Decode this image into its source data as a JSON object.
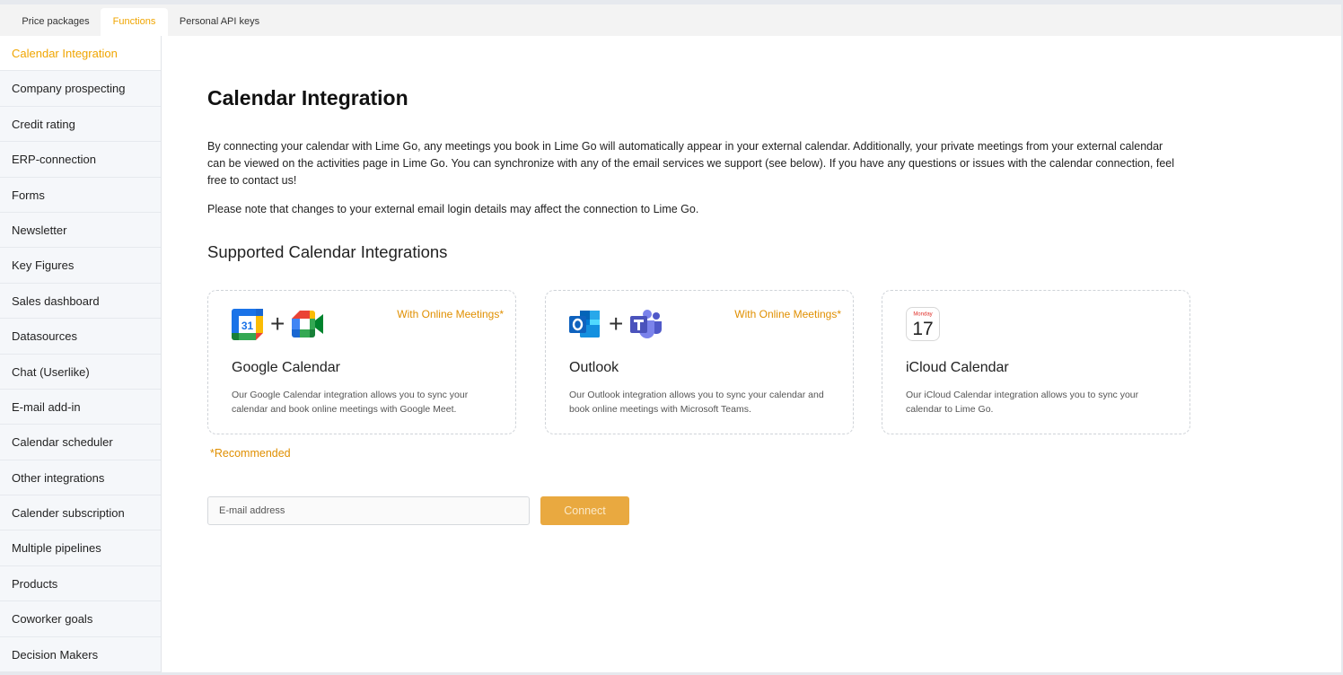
{
  "tabs": [
    {
      "label": "Price packages"
    },
    {
      "label": "Functions",
      "active": true
    },
    {
      "label": "Personal API keys"
    }
  ],
  "sidebar": {
    "items": [
      {
        "label": "Calendar Integration",
        "active": true
      },
      {
        "label": "Company prospecting"
      },
      {
        "label": "Credit rating"
      },
      {
        "label": "ERP-connection"
      },
      {
        "label": "Forms"
      },
      {
        "label": "Newsletter"
      },
      {
        "label": "Key Figures"
      },
      {
        "label": "Sales dashboard"
      },
      {
        "label": "Datasources"
      },
      {
        "label": "Chat (Userlike)"
      },
      {
        "label": "E-mail add-in"
      },
      {
        "label": "Calendar scheduler"
      },
      {
        "label": "Other integrations"
      },
      {
        "label": "Calender subscription"
      },
      {
        "label": "Multiple pipelines"
      },
      {
        "label": "Products"
      },
      {
        "label": "Coworker goals"
      },
      {
        "label": "Decision Makers"
      }
    ]
  },
  "main": {
    "title": "Calendar Integration",
    "intro": "By connecting your calendar with Lime Go, any meetings you book in Lime Go will automatically appear in your external calendar. Additionally, your private meetings from your external calendar can be viewed on the activities page in Lime Go. You can synchronize with any of the email services we support (see below). If you have any questions or issues with the calendar connection, feel free to contact us!",
    "note": "Please note that changes to your external email login details may affect the connection to Lime Go.",
    "supported_heading": "Supported Calendar Integrations",
    "cards": [
      {
        "title": "Google Calendar",
        "badge": "With Online Meetings*",
        "plus": "+",
        "calendar_day": "31",
        "description": "Our Google Calendar integration allows you to sync your calendar and book online meetings with Google Meet.",
        "icons": [
          "google-calendar-icon",
          "google-meet-icon"
        ]
      },
      {
        "title": "Outlook",
        "badge": "With Online Meetings*",
        "plus": "+",
        "description": "Our Outlook integration allows you to sync your calendar and book online meetings with Microsoft Teams.",
        "icons": [
          "outlook-icon",
          "microsoft-teams-icon"
        ]
      },
      {
        "title": "iCloud Calendar",
        "badge": "",
        "calendar_weekday": "Monday",
        "calendar_day": "17",
        "description": "Our iCloud Calendar integration allows you to sync your calendar to Lime Go.",
        "icons": [
          "icloud-calendar-icon"
        ]
      }
    ],
    "recommended": "*Recommended",
    "email": {
      "placeholder": "E-mail address",
      "value": ""
    },
    "connect_label": "Connect"
  },
  "colors": {
    "accent": "#f0a500",
    "badge": "#e08f00",
    "button": "#e9a940",
    "sidebar_bg": "#f5f7fa"
  }
}
